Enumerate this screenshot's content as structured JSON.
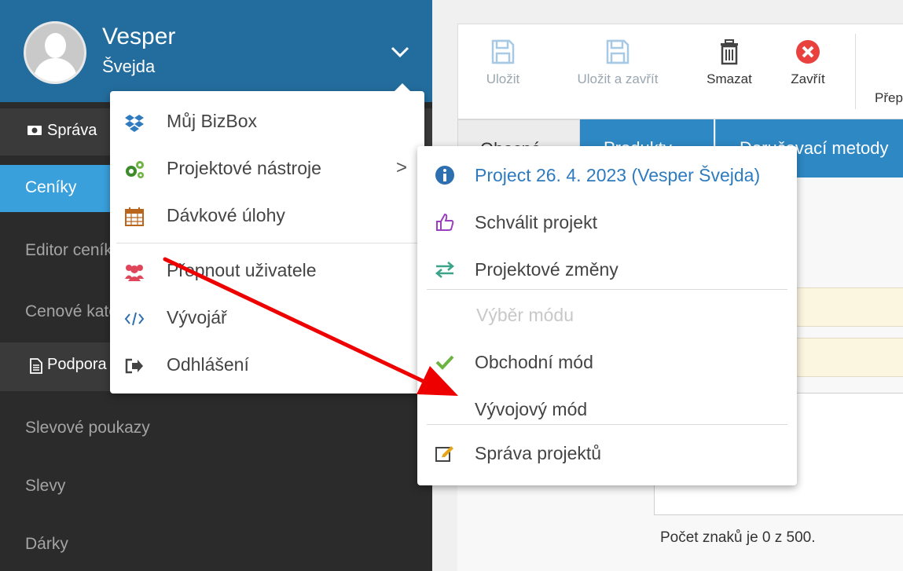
{
  "user": {
    "first_name": "Vesper",
    "last_name": "Švejda"
  },
  "sidebar": {
    "sections": [
      {
        "label": "Správa",
        "icon": "money-icon"
      },
      {
        "label": "Podpora",
        "icon": "document-icon"
      }
    ],
    "items": [
      {
        "label": "Ceníky",
        "active": true
      },
      {
        "label": "Editor ceníků",
        "active": false
      },
      {
        "label": "Cenové kategorie",
        "active": false
      },
      {
        "label": "Slevové poukazy",
        "active": false
      },
      {
        "label": "Slevy",
        "active": false
      },
      {
        "label": "Dárky",
        "active": false
      }
    ]
  },
  "toolbar": {
    "save": "Uložit",
    "save_close": "Uložit a zavřít",
    "delete": "Smazat",
    "close": "Zavřít",
    "more": "Přepnout"
  },
  "tabs": [
    {
      "label": "Obecné",
      "active": false
    },
    {
      "label": "Produkty",
      "active": true
    },
    {
      "label": "Doručovací metody",
      "active": true
    }
  ],
  "content": {
    "char_count": "Počet znaků je 0 z 500."
  },
  "user_menu": {
    "items": [
      {
        "label": "Můj BizBox",
        "icon": "dropbox-icon"
      },
      {
        "label": "Projektové nástroje",
        "icon": "gears-icon",
        "submenu_arrow": ">"
      },
      {
        "label": "Dávkové úlohy",
        "icon": "calendar-icon"
      },
      {
        "label": "Přepnout uživatele",
        "icon": "users-icon"
      },
      {
        "label": "Vývojář",
        "icon": "code-icon"
      },
      {
        "label": "Odhlášení",
        "icon": "sign-out-icon"
      }
    ]
  },
  "project_menu": {
    "project_label": "Project 26. 4. 2023 (Vesper Švejda)",
    "approve": "Schválit projekt",
    "changes": "Projektové změny",
    "mode_header": "Výběr módu",
    "business_mode": "Obchodní mód",
    "dev_mode": "Vývojový mód",
    "manage": "Správa projektů"
  },
  "colors": {
    "header_blue": "#236d9e",
    "sidebar_dark": "#2b2b2b",
    "active_blue": "#3aa0dc",
    "tab_blue": "#2e88c4",
    "arrow_red": "#ee0000",
    "close_red": "#e8413e",
    "check_green": "#6cb33f"
  }
}
